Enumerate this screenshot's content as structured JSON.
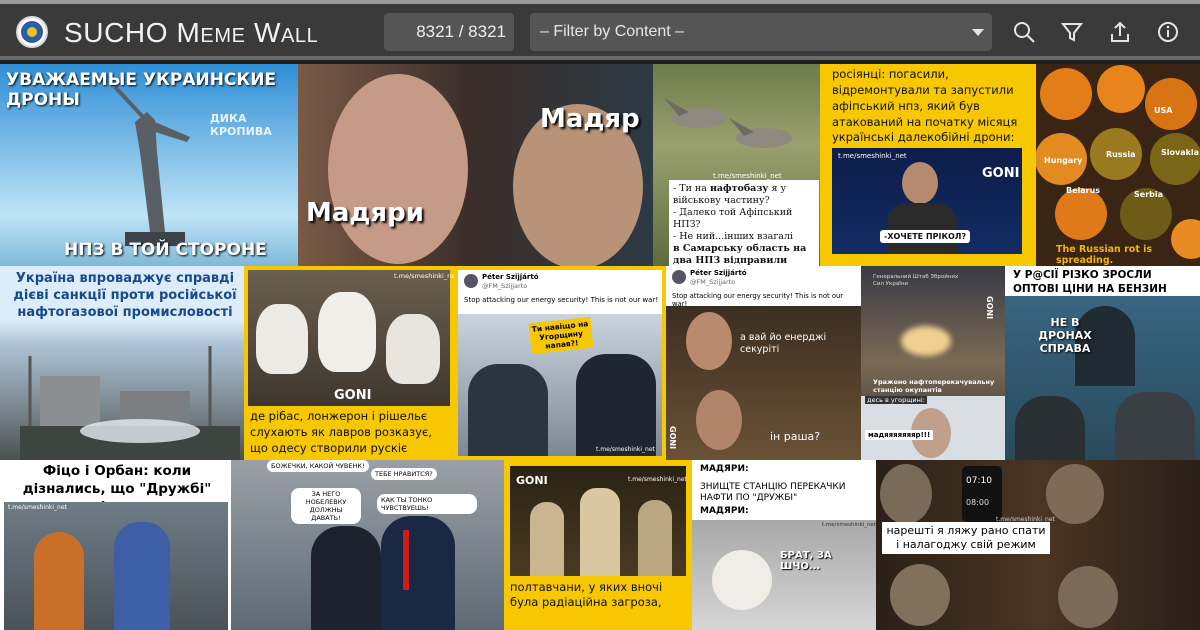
{
  "app": {
    "title": "SUCHO Meme Wall",
    "counter": "8321 / 8321",
    "filter_placeholder": "– Filter by Content –"
  },
  "toolbar": {
    "search_icon": "search-icon",
    "filter_icon": "filter-icon",
    "share_icon": "share-icon",
    "info_icon": "info-icon"
  },
  "memes": {
    "m1": {
      "title": "УВАЖАЕМЫЕ УКРАИНСКИЕ ДРОНЫ",
      "bottom": "НПЗ В ТОЙ СТОРОНЕ",
      "watermark": "ДИКА КРОПИВА"
    },
    "m2": {
      "left_label": "Мадяри",
      "right_label": "Мадяр"
    },
    "m3": {
      "handle": "t.me/smeshinki_net",
      "l1a": "- Ти на ",
      "l1b": "нафтобазу",
      "l1c": " я у",
      "l2": "військову частину?",
      "l3": "- Далеко той Афіпський НПЗ?",
      "l4": "- Не ний...інших взагалі",
      "l5": "в Самарську область на",
      "l6": "два НПЗ відправили"
    },
    "m4": {
      "text": "росіянці: погасили, відремонтували та запустили афіпський нпз, який був атакований на початку місяця",
      "sub": "українські далекобійні дрони:",
      "handle": "t.me/smeshinki_net",
      "bubble": "-ХОЧЕТЕ ПРІКОЛ?",
      "brand": "GONI"
    },
    "m5": {
      "labels": [
        "USA",
        "Hungary",
        "Russia",
        "Slovakia",
        "Belarus",
        "Serbia"
      ],
      "caption": "The Russian rot is spreading."
    },
    "m6": {
      "text": "Україна впроваджує справді дієві санкції проти російської нафтогазової промисловості"
    },
    "m7": {
      "handle": "t.me/smeshinki_net",
      "brand": "GONI",
      "caption": "де рібас, лонжерон і рішельє слухають як лавров розказує, що одесу створили рускіє"
    },
    "m8": {
      "name": "Péter Szijjártó",
      "at": "@FM_Szijjarto",
      "tweet": "Stop attacking our energy security! This is not our war!",
      "sign": "Ти навіщо на Угорщину напав?!",
      "handle": "t.me/smeshinki_net"
    },
    "m9": {
      "name": "Péter Szijjártó",
      "at": "@FM_Szijjarto",
      "tweet": "Stop attacking our energy security! This is not our war!",
      "bubble1": "а вай йо енерджі секуріті",
      "bubble2": "ін раша?",
      "brand": "GONI"
    },
    "m10": {
      "source": "Генеральний Штаб Збройних Сил України",
      "brand": "GONI",
      "caption": "Уражено нафтоперекачувальну станцію окупантів",
      "sub": "десь в угорщині:",
      "bubble": "мадяяяяяяяр!!!"
    },
    "m11": {
      "title": "У Р@СІЇ РІЗКО ЗРОСЛИ ОПТОВІ ЦІНИ НА БЕНЗИН",
      "bubble": "НЕ В ДРОНАХ СПРАВА"
    },
    "m12": {
      "title": "Фіцо і Орбан: коли дізнались, що \"Дружбі\" кінець",
      "handle": "t.me/smeshinki_net"
    },
    "m13": {
      "b1": "БОЖЕЧКИ, КАКОЙ ЧУВЕНК!",
      "b2": "ТЕБЕ НРАВИТСЯ?",
      "b3": "ЗА НЕГО НОБЕЛЕВКУ ДОЛЖНЫ ДАВАТЬ!",
      "b4": "КАК ТЫ ТОНКО ЧУВСТВУЕШЬ!"
    },
    "m14": {
      "brand": "GONI",
      "handle": "t.me/smeshinki_net",
      "caption": "полтавчани, у яких вночі була радіаційна загроза,"
    },
    "m15": {
      "l1": "МАДЯРИ:",
      "l2": "ЗНИЩТЕ СТАНЦІЮ ПЕРЕКАЧКИ НАФТИ ПО \"ДРУЖБІ\"",
      "l3": "МАДЯРИ:",
      "handle": "t.me/smeshinki_net",
      "bubble": "БРАТ, ЗА ШЧО..."
    },
    "m16": {
      "clock": "07:10",
      "alarm": "08:00",
      "handle": "t.me/smeshinki_net",
      "caption": "нарешті я ляжу рано спати і налагоджу свій режим"
    }
  }
}
